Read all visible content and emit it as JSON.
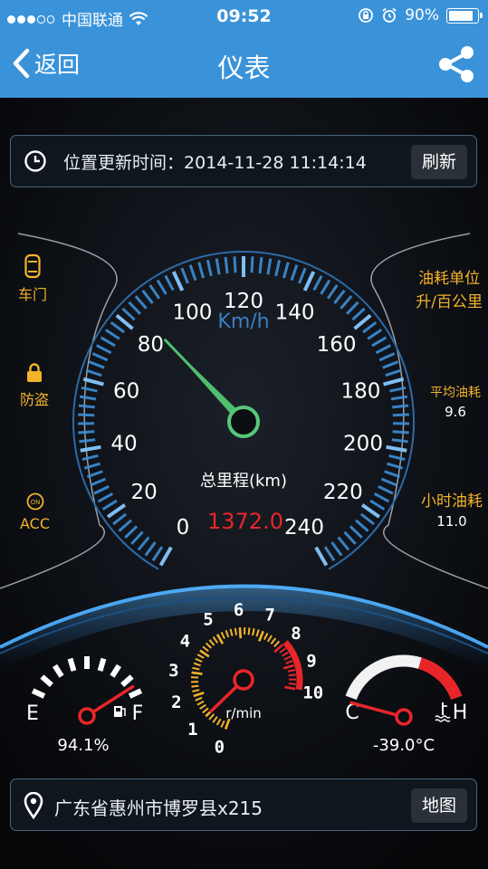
{
  "status_bar": {
    "carrier": "中国联通",
    "time": "09:52",
    "battery": "90%"
  },
  "nav": {
    "back_label": "返回",
    "title": "仪表"
  },
  "location_time": {
    "label": "位置更新时间：",
    "value": "2014-11-28 11:14:14",
    "refresh_label": "刷新"
  },
  "left_indicators": [
    {
      "label": "车门",
      "icon": "car-door-icon"
    },
    {
      "label": "防盗",
      "icon": "lock-icon"
    },
    {
      "label": "ACC",
      "icon": "power-icon"
    }
  ],
  "right_info": {
    "fuel_unit_label_1": "油耗单位",
    "fuel_unit_label_2": "升/百公里",
    "avg_fuel_label": "平均油耗",
    "avg_fuel_value": "9.6",
    "hourly_fuel_label": "小时油耗",
    "hourly_fuel_value": "11.0"
  },
  "speedometer": {
    "unit": "Km/h",
    "ticks": [
      "0",
      "20",
      "40",
      "60",
      "80",
      "100",
      "120",
      "140",
      "160",
      "180",
      "200",
      "220",
      "240"
    ],
    "min": 0,
    "max": 240,
    "speed": 85,
    "odometer_label": "总里程(km)",
    "odometer_value": "1372.0",
    "colors": {
      "scale": "#3d8fd8",
      "needle": "#4fbf6f",
      "odometer": "#e8262a"
    }
  },
  "fuel_gauge": {
    "empty_label": "E",
    "full_label": "F",
    "level": 0.941,
    "value": "94.1%"
  },
  "tachometer": {
    "unit": "r/min",
    "ticks": [
      "0",
      "1",
      "2",
      "3",
      "4",
      "5",
      "6",
      "7",
      "8",
      "9",
      "10"
    ],
    "rpm": 1.0,
    "redline": 8
  },
  "temp_gauge": {
    "cold_label": "C",
    "hot_label": "H",
    "value": "-39.0°C",
    "level": 0.0
  },
  "address": {
    "text": "广东省惠州市博罗县x215",
    "map_label": "地图"
  }
}
